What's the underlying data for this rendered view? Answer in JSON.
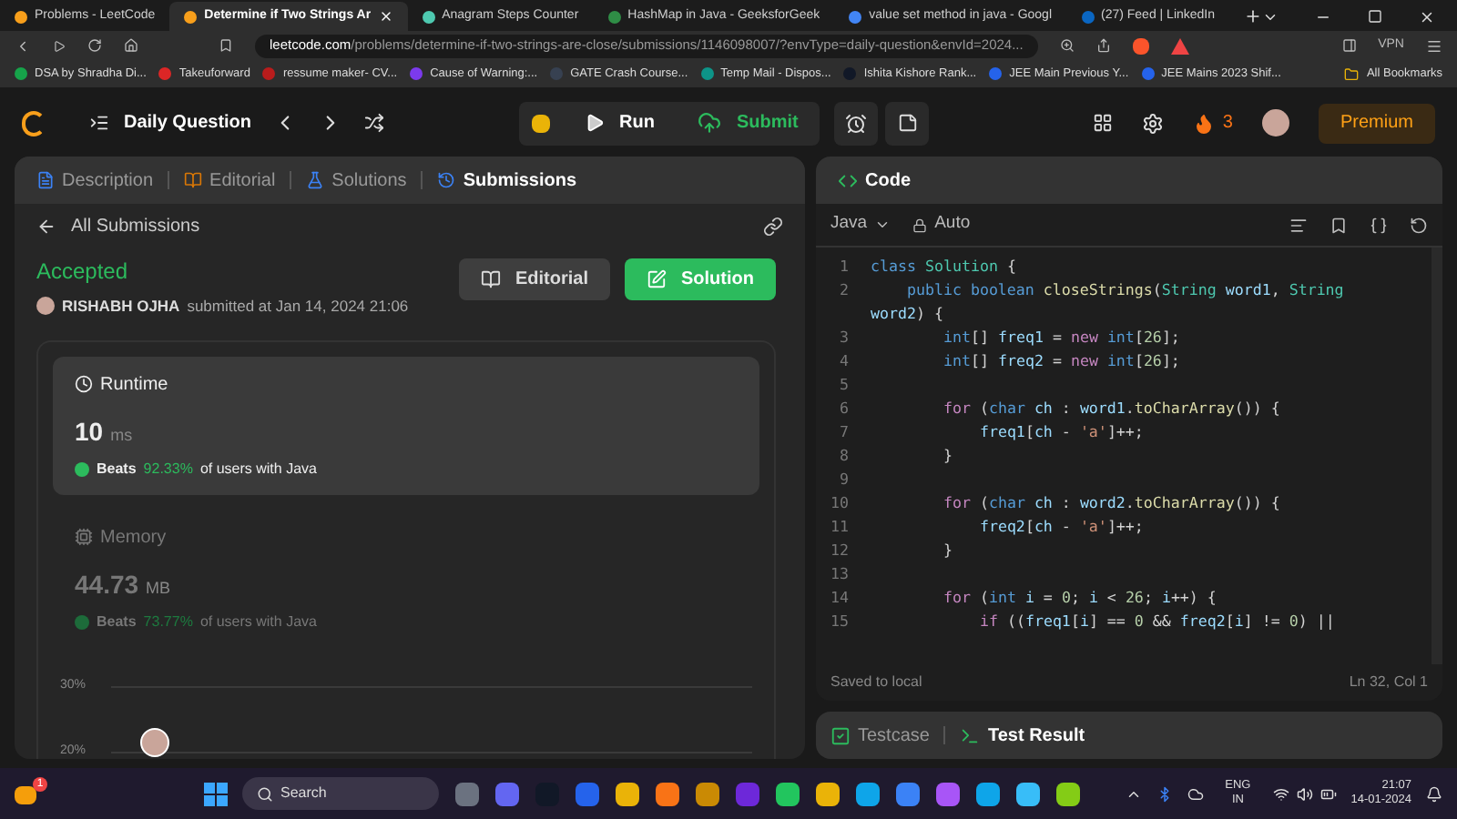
{
  "browser": {
    "tabs": [
      {
        "title": "Problems - LeetCode",
        "selected": false
      },
      {
        "title": "Determine if Two Strings Ar",
        "selected": true
      },
      {
        "title": "Anagram Steps Counter",
        "selected": false
      },
      {
        "title": "HashMap in Java - GeeksforGeek",
        "selected": false
      },
      {
        "title": "value set method in java - Googl",
        "selected": false
      },
      {
        "title": "(27) Feed | LinkedIn",
        "selected": false
      }
    ],
    "url_host": "leetcode.com",
    "url_path": "/problems/determine-if-two-strings-are-close/submissions/1146098007/?envType=daily-question&envId=2024...",
    "vpn": "VPN",
    "bookmarks": [
      "DSA by Shradha Di...",
      "Takeuforward",
      "ressume maker- CV...",
      "Cause of Warning:...",
      "GATE Crash Course...",
      "Temp Mail - Dispos...",
      "Ishita Kishore Rank...",
      "JEE Main Previous Y...",
      "JEE Mains 2023 Shif..."
    ],
    "all_bookmarks": "All Bookmarks"
  },
  "header": {
    "title": "Daily Question",
    "run": "Run",
    "submit": "Submit",
    "streak": "3",
    "premium": "Premium"
  },
  "left": {
    "tabs": [
      {
        "label": "Description",
        "selected": false
      },
      {
        "label": "Editorial",
        "selected": false
      },
      {
        "label": "Solutions",
        "selected": false
      },
      {
        "label": "Submissions",
        "selected": true
      }
    ],
    "back": "All Submissions",
    "status": "Accepted",
    "user": "RISHABH OJHA",
    "submitted": "submitted at Jan 14, 2024 21:06",
    "editorial": "Editorial",
    "solution": "Solution",
    "metrics": [
      {
        "kind": "runtime",
        "title": "Runtime",
        "value": "10",
        "unit": "ms",
        "beats": "Beats",
        "percent": "92.33%",
        "suffix": "of users with Java",
        "selected": true
      },
      {
        "kind": "memory",
        "title": "Memory",
        "value": "44.73",
        "unit": "MB",
        "beats": "Beats",
        "percent": "73.77%",
        "suffix": "of users with Java",
        "selected": false
      }
    ],
    "chart_labels": [
      "30%",
      "20%"
    ]
  },
  "right": {
    "title": "Code",
    "language": "Java",
    "mode": "Auto",
    "lines": [
      {
        "n": "1",
        "t": [
          {
            "kind": "kw",
            "text": "class "
          },
          {
            "kind": "cls",
            "text": "Solution"
          },
          {
            "kind": "p",
            "text": " {"
          }
        ]
      },
      {
        "n": "2",
        "t": [
          {
            "kind": "kw",
            "text": "    public boolean "
          },
          {
            "kind": "fn",
            "text": "closeStrings"
          },
          {
            "kind": "p",
            "text": "("
          },
          {
            "kind": "cls",
            "text": "String "
          },
          {
            "kind": "var",
            "text": "word1"
          },
          {
            "kind": "p",
            "text": ", "
          },
          {
            "kind": "cls",
            "text": "String "
          },
          {
            "kind": "var",
            "text": "word2"
          },
          {
            "kind": "p",
            "text": ") {"
          }
        ]
      },
      {
        "n": "3",
        "t": [
          {
            "kind": "kw",
            "text": "        int"
          },
          {
            "kind": "p",
            "text": "[] "
          },
          {
            "kind": "var",
            "text": "freq1"
          },
          {
            "kind": "p",
            "text": " = "
          },
          {
            "kind": "ctrl",
            "text": "new "
          },
          {
            "kind": "kw",
            "text": "int"
          },
          {
            "kind": "p",
            "text": "["
          },
          {
            "kind": "num",
            "text": "26"
          },
          {
            "kind": "p",
            "text": "];"
          }
        ]
      },
      {
        "n": "4",
        "t": [
          {
            "kind": "kw",
            "text": "        int"
          },
          {
            "kind": "p",
            "text": "[] "
          },
          {
            "kind": "var",
            "text": "freq2"
          },
          {
            "kind": "p",
            "text": " = "
          },
          {
            "kind": "ctrl",
            "text": "new "
          },
          {
            "kind": "kw",
            "text": "int"
          },
          {
            "kind": "p",
            "text": "["
          },
          {
            "kind": "num",
            "text": "26"
          },
          {
            "kind": "p",
            "text": "];"
          }
        ]
      },
      {
        "n": "5"
      },
      {
        "n": "6",
        "t": [
          {
            "kind": "ctrl",
            "text": "        for "
          },
          {
            "kind": "p",
            "text": "("
          },
          {
            "kind": "kw",
            "text": "char "
          },
          {
            "kind": "var",
            "text": "ch"
          },
          {
            "kind": "p",
            "text": " : "
          },
          {
            "kind": "var",
            "text": "word1"
          },
          {
            "kind": "p",
            "text": "."
          },
          {
            "kind": "fn",
            "text": "toCharArray"
          },
          {
            "kind": "p",
            "text": "()) {"
          }
        ]
      },
      {
        "n": "7",
        "t": [
          {
            "kind": "var",
            "text": "            freq1"
          },
          {
            "kind": "p",
            "text": "["
          },
          {
            "kind": "var",
            "text": "ch"
          },
          {
            "kind": "p",
            "text": " - "
          },
          {
            "kind": "str",
            "text": "'a'"
          },
          {
            "kind": "p",
            "text": "]++;"
          }
        ]
      },
      {
        "n": "8",
        "t": [
          {
            "kind": "p",
            "text": "        }"
          }
        ]
      },
      {
        "n": "9"
      },
      {
        "n": "10",
        "t": [
          {
            "kind": "ctrl",
            "text": "        for "
          },
          {
            "kind": "p",
            "text": "("
          },
          {
            "kind": "kw",
            "text": "char "
          },
          {
            "kind": "var",
            "text": "ch"
          },
          {
            "kind": "p",
            "text": " : "
          },
          {
            "kind": "var",
            "text": "word2"
          },
          {
            "kind": "p",
            "text": "."
          },
          {
            "kind": "fn",
            "text": "toCharArray"
          },
          {
            "kind": "p",
            "text": "()) {"
          }
        ]
      },
      {
        "n": "11",
        "t": [
          {
            "kind": "var",
            "text": "            freq2"
          },
          {
            "kind": "p",
            "text": "["
          },
          {
            "kind": "var",
            "text": "ch"
          },
          {
            "kind": "p",
            "text": " - "
          },
          {
            "kind": "str",
            "text": "'a'"
          },
          {
            "kind": "p",
            "text": "]++;"
          }
        ]
      },
      {
        "n": "12",
        "t": [
          {
            "kind": "p",
            "text": "        }"
          }
        ]
      },
      {
        "n": "13"
      },
      {
        "n": "14",
        "t": [
          {
            "kind": "ctrl",
            "text": "        for "
          },
          {
            "kind": "p",
            "text": "("
          },
          {
            "kind": "kw",
            "text": "int "
          },
          {
            "kind": "var",
            "text": "i"
          },
          {
            "kind": "p",
            "text": " = "
          },
          {
            "kind": "num",
            "text": "0"
          },
          {
            "kind": "p",
            "text": "; "
          },
          {
            "kind": "var",
            "text": "i"
          },
          {
            "kind": "p",
            "text": " < "
          },
          {
            "kind": "num",
            "text": "26"
          },
          {
            "kind": "p",
            "text": "; "
          },
          {
            "kind": "var",
            "text": "i"
          },
          {
            "kind": "p",
            "text": "++) {"
          }
        ]
      },
      {
        "n": "15",
        "t": [
          {
            "kind": "ctrl",
            "text": "            if "
          },
          {
            "kind": "p",
            "text": "(("
          },
          {
            "kind": "var",
            "text": "freq1"
          },
          {
            "kind": "p",
            "text": "["
          },
          {
            "kind": "var",
            "text": "i"
          },
          {
            "kind": "p",
            "text": "] == "
          },
          {
            "kind": "num",
            "text": "0"
          },
          {
            "kind": "p",
            "text": " && "
          },
          {
            "kind": "var",
            "text": "freq2"
          },
          {
            "kind": "p",
            "text": "["
          },
          {
            "kind": "var",
            "text": "i"
          },
          {
            "kind": "p",
            "text": "] != "
          },
          {
            "kind": "num",
            "text": "0"
          },
          {
            "kind": "p",
            "text": ") ||"
          }
        ]
      }
    ],
    "saved": "Saved to local",
    "position": "Ln 32, Col 1",
    "bottom_tabs": [
      {
        "label": "Testcase",
        "selected": false
      },
      {
        "label": "Test Result",
        "selected": true
      }
    ]
  },
  "taskbar": {
    "badge": "1",
    "search": "Search",
    "lang": "ENG",
    "region": "IN",
    "time": "21:07",
    "date": "14-01-2024"
  }
}
